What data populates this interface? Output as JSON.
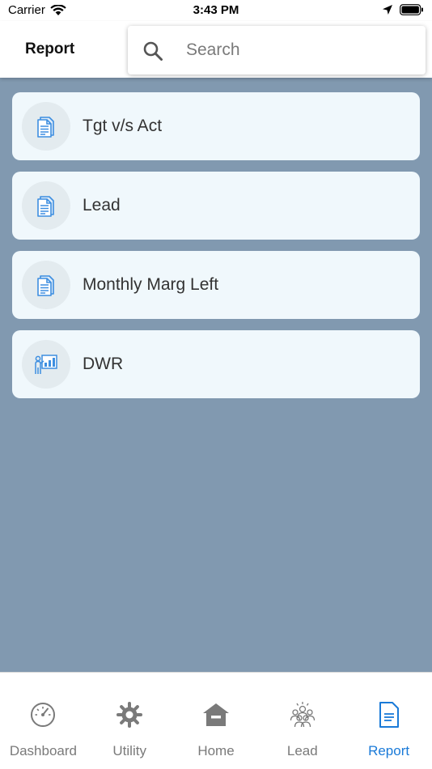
{
  "status_bar": {
    "carrier": "Carrier",
    "time": "3:43 PM"
  },
  "header": {
    "title": "Report"
  },
  "search": {
    "placeholder": "Search"
  },
  "reports": [
    {
      "label": "Tgt v/s Act",
      "icon": "document-icon"
    },
    {
      "label": "Lead",
      "icon": "document-icon"
    },
    {
      "label": "Monthly Marg Left",
      "icon": "document-icon"
    },
    {
      "label": "DWR",
      "icon": "presentation-chart-icon"
    }
  ],
  "tab_bar": {
    "tabs": [
      {
        "label": "Dashboard",
        "icon": "speedometer-icon",
        "active": false
      },
      {
        "label": "Utility",
        "icon": "gear-icon",
        "active": false
      },
      {
        "label": "Home",
        "icon": "home-icon",
        "active": false
      },
      {
        "label": "Lead",
        "icon": "people-group-icon",
        "active": false
      },
      {
        "label": "Report",
        "icon": "document-icon",
        "active": true
      }
    ]
  },
  "colors": {
    "background": "#8199b0",
    "card": "#f0f8fc",
    "icon_blue": "#3d8ee0",
    "active_tab": "#1a7ad8",
    "inactive_tab": "#7a7a7a"
  }
}
